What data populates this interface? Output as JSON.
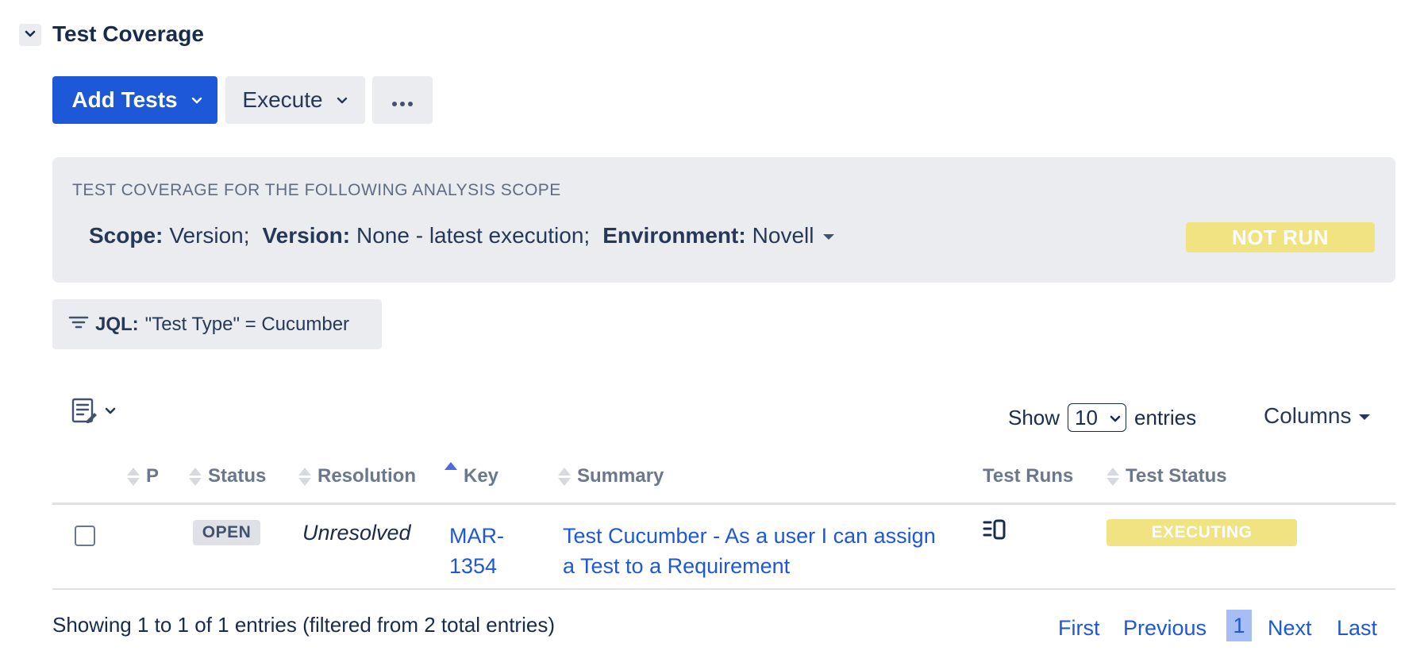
{
  "section": {
    "title": "Test Coverage"
  },
  "toolbar": {
    "add_tests_label": "Add Tests",
    "execute_label": "Execute",
    "more_label": "•••"
  },
  "scope": {
    "heading": "TEST COVERAGE FOR THE FOLLOWING ANALYSIS SCOPE",
    "scope_label": "Scope:",
    "scope_value": "Version;",
    "version_label": "Version:",
    "version_value": "None - latest execution;",
    "environment_label": "Environment:",
    "environment_value": "Novell",
    "status": "NOT RUN"
  },
  "filter": {
    "jql_label": "JQL:",
    "jql_value": "\"Test Type\" = Cucumber"
  },
  "controls": {
    "show_label": "Show",
    "page_size": "10",
    "entries_label": "entries",
    "columns_label": "Columns"
  },
  "table": {
    "headers": {
      "p": "P",
      "status": "Status",
      "resolution": "Resolution",
      "key": "Key",
      "summary": "Summary",
      "test_runs": "Test Runs",
      "test_status": "Test Status"
    },
    "rows": [
      {
        "status": "OPEN",
        "resolution": "Unresolved",
        "key_line1": "MAR-",
        "key_line2": "1354",
        "summary_line1": "Test Cucumber - As a user I can assign",
        "summary_line2": "a Test to a Requirement",
        "test_status": "EXECUTING"
      }
    ]
  },
  "footer": {
    "info": "Showing 1 to 1 of 1 entries (filtered from 2 total entries)",
    "first": "First",
    "previous": "Previous",
    "current_page": "1",
    "next": "Next",
    "last": "Last"
  },
  "colors": {
    "primary": "#1d58d8",
    "not_run": "#f1e282",
    "executing": "#f1e282",
    "panel": "#ebecf0"
  }
}
